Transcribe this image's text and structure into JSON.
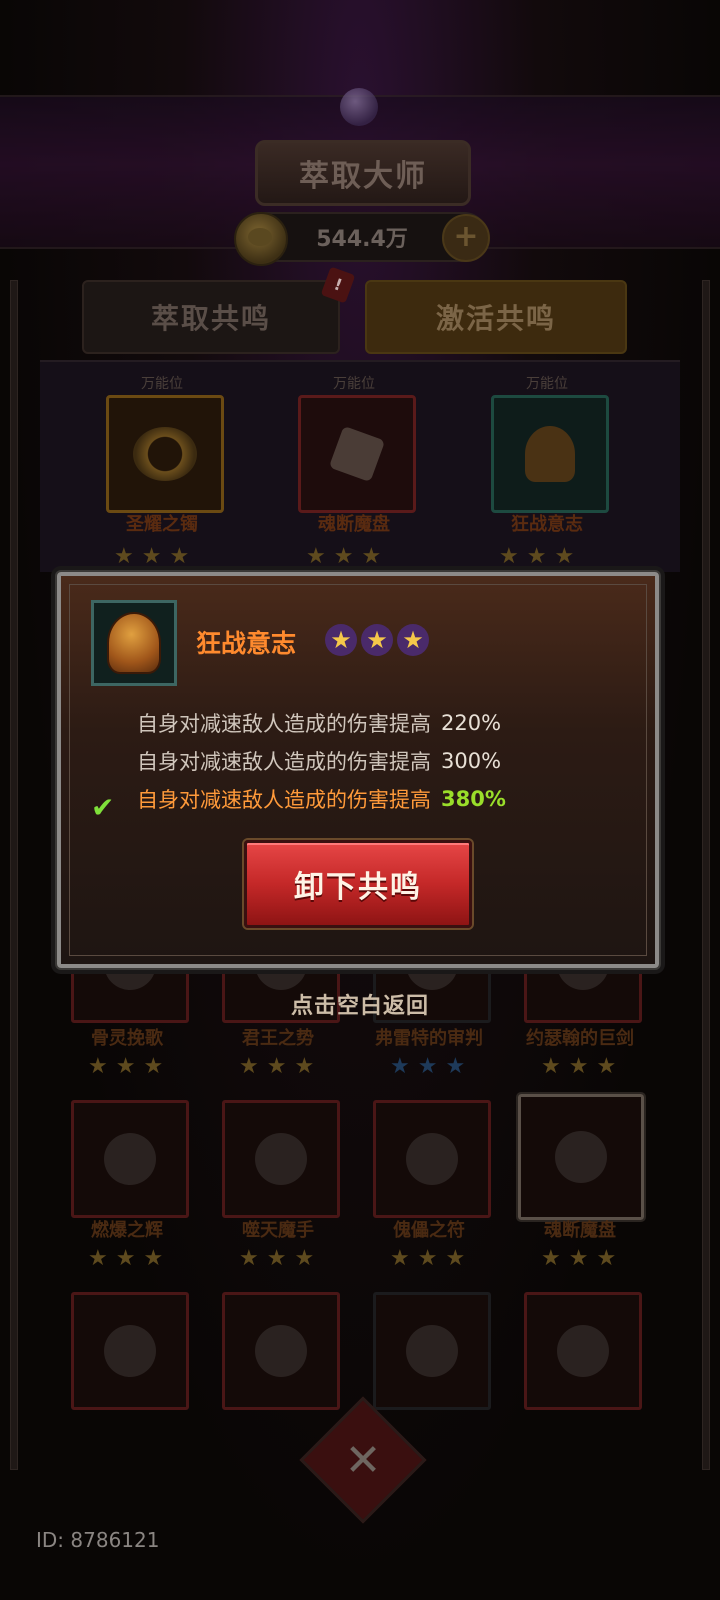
{
  "header": {
    "title": "萃取大师"
  },
  "currency": {
    "amount": "544.4万",
    "plus_label": "+"
  },
  "tabs": [
    {
      "label": "萃取共鸣",
      "active": false,
      "badge": "!"
    },
    {
      "label": "激活共鸣",
      "active": true
    }
  ],
  "slots": [
    {
      "tag": "万能位",
      "name": "圣耀之镯",
      "stars": 3
    },
    {
      "tag": "万能位",
      "name": "魂断魔盘",
      "stars": 3
    },
    {
      "tag": "万能位",
      "name": "狂战意志",
      "stars": 3
    }
  ],
  "grid": {
    "row1": [
      {
        "name": "骨灵挽歌",
        "stars": 3
      },
      {
        "name": "君王之势",
        "stars": 3
      },
      {
        "name": "弗雷特的审判",
        "stars": 3
      },
      {
        "name": "约瑟翰的巨剑",
        "stars": 3
      }
    ],
    "row2": [
      {
        "name": "燃爆之辉",
        "stars": 3
      },
      {
        "name": "噬天魔手",
        "stars": 3
      },
      {
        "name": "傀儡之符",
        "stars": 3
      },
      {
        "name": "魂断魔盘",
        "stars": 3
      }
    ]
  },
  "popup": {
    "item_name": "狂战意志",
    "stars": 3,
    "effects": [
      {
        "desc": "自身对减速敌人造成的伤害提高",
        "value": "220%",
        "active": false
      },
      {
        "desc": "自身对减速敌人造成的伤害提高",
        "value": "300%",
        "active": false
      },
      {
        "desc": "自身对减速敌人造成的伤害提高",
        "value": "380%",
        "active": true
      }
    ],
    "button_label": "卸下共鸣"
  },
  "dismiss_hint": "点击空白返回",
  "player_id": "ID: 8786121",
  "colors": {
    "title_orange": "#ff8a2e",
    "active_green": "#9ade2a",
    "button_red": "#c42828"
  }
}
